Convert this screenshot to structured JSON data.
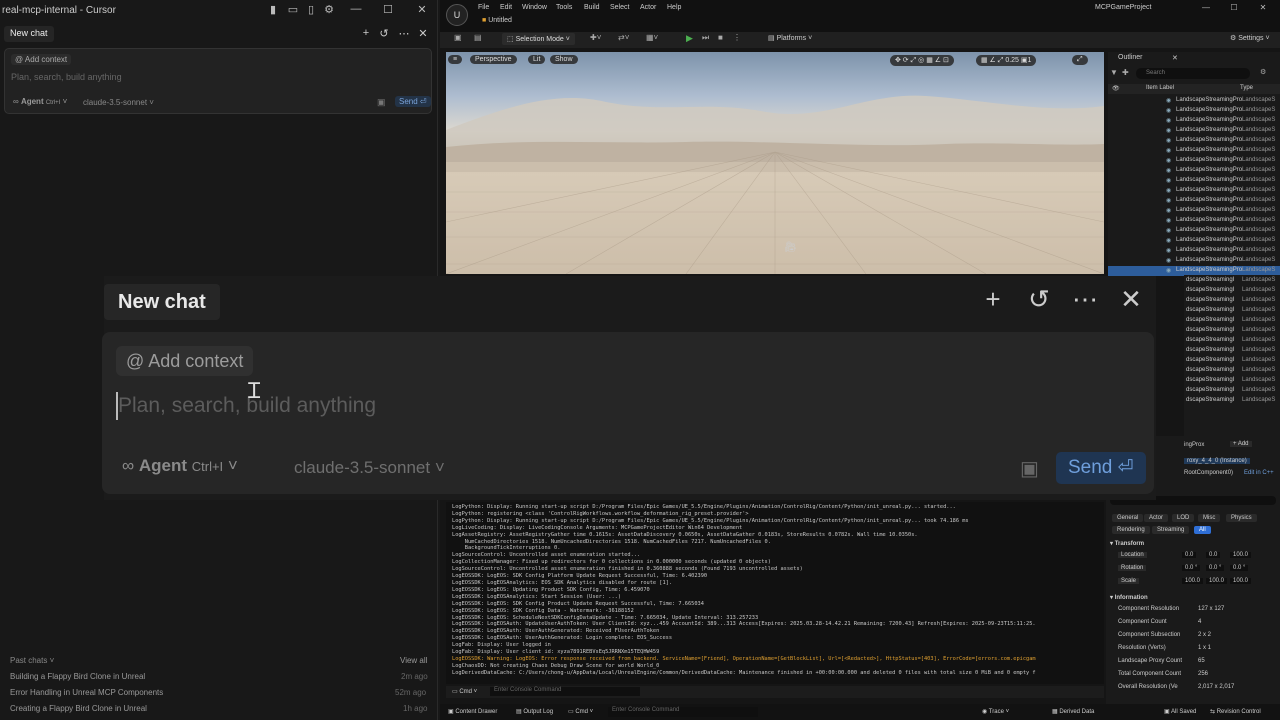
{
  "cursor": {
    "window_title": "real-mcp-internal - Cursor",
    "tab": "New chat",
    "add_context": "Add context",
    "placeholder": "Plan, search, build anything",
    "agent": "Agent",
    "agent_shortcut": "Ctrl+I",
    "model": "claude-3.5-sonnet",
    "send": "Send",
    "past_chats_label": "Past chats",
    "view_all": "View all",
    "past_chats": [
      {
        "title": "Building a Flappy Bird Clone in Unreal",
        "time": "2m ago"
      },
      {
        "title": "Error Handling in Unreal MCP Components",
        "time": "52m ago"
      },
      {
        "title": "Creating a Flappy Bird Clone in Unreal",
        "time": "1h ago"
      }
    ]
  },
  "unreal": {
    "menu": [
      "File",
      "Edit",
      "Window",
      "Tools",
      "Build",
      "Select",
      "Actor",
      "Help"
    ],
    "level": "Untitled",
    "project": "MCPGameProject",
    "selection_mode": "Selection Mode",
    "platforms": "Platforms",
    "settings": "Settings",
    "viewport_buttons": [
      "Perspective",
      "Lit",
      "Show"
    ],
    "outliner_title": "Outliner",
    "search_placeholder": "Search",
    "col_item": "Item Label",
    "col_type": "Type",
    "outliner_item": "LandscapeStreamingPro",
    "outliner_type": "LandscapeS",
    "outliner_lower_item": "dscapeStreamingI",
    "details_actor": "ingProx",
    "add_button": "+ Add",
    "details_instance": "roxy_4_4_0 (Instance)",
    "details_component": "RootComponent0)",
    "edit_in_cpp": "Edit in C++",
    "detail_tabs_row1": [
      "General",
      "Actor",
      "LOD",
      "Misc",
      "Physics"
    ],
    "detail_tabs_row2": [
      "Rendering",
      "Streaming",
      "All"
    ],
    "transform_label": "Transform",
    "transform": [
      {
        "label": "Location",
        "values": [
          "0.0",
          "0.0",
          "100.0"
        ]
      },
      {
        "label": "Rotation",
        "values": [
          "0.0 °",
          "0.0 °",
          "0.0 °"
        ]
      },
      {
        "label": "Scale",
        "values": [
          "100.0",
          "100.0",
          "100.0"
        ]
      }
    ],
    "information_label": "Information",
    "information": [
      {
        "label": "Component Resolution",
        "value": "127 x 127"
      },
      {
        "label": "Component Count",
        "value": "4"
      },
      {
        "label": "Component Subsection",
        "value": "2 x 2"
      },
      {
        "label": "Resolution (Verts)",
        "value": "1 x 1"
      },
      {
        "label": "Landscape Proxy Count",
        "value": "65"
      },
      {
        "label": "Total Component Count",
        "value": "256"
      },
      {
        "label": "Overall Resolution (Ve",
        "value": "2,017 x 2,017"
      }
    ],
    "log_lines": [
      {
        "text": "LogPython: Display: Running start-up script D:/Program Files/Epic Games/UE_5.5/Engine/Plugins/Animation/ControlRig/Content/Python/init_unreal.py... started...",
        "level": "normal"
      },
      {
        "text": "LogPython: registering <class 'ControlRigWorkflows.workflow_deformation_rig_preset.provider'>",
        "level": "normal"
      },
      {
        "text": "LogPython: Display: Running start-up script D:/Program Files/Epic Games/UE_5.5/Engine/Plugins/Animation/ControlRig/Content/Python/init_unreal.py... took 74.186 ms",
        "level": "normal"
      },
      {
        "text": "LogLiveCoding: Display: LiveCodingConsole Arguments: MCPGameProjectEditor Win64 Development",
        "level": "normal"
      },
      {
        "text": "LogAssetRegistry: AssetRegistryGather time 0.1615s: AssetDataDiscovery 0.0650s, AssetDataGather 0.0183s, StoreResults 0.0782s. Wall time 10.0350s.",
        "level": "normal"
      },
      {
        "text": "    NumCachedDirectories 1518. NumUncachedDirectories 1518. NumCachedFiles 7217. NumUncachedFiles 0.",
        "level": "normal"
      },
      {
        "text": "    BackgroundTickInterruptions 0.",
        "level": "normal"
      },
      {
        "text": "LogSourceControl: Uncontrolled asset enumeration started...",
        "level": "normal"
      },
      {
        "text": "LogCollectionManager: Fixed up redirectors for 0 collections in 0.000000 seconds (updated 0 objects)",
        "level": "normal"
      },
      {
        "text": "LogSourceControl: Uncontrolled asset enumeration finished in 0.360888 seconds (Found 7193 uncontrolled assets)",
        "level": "normal"
      },
      {
        "text": "LogEOSSDK: LogEOS: SDK Config Platform Update Request Successful, Time: 6.402390",
        "level": "normal"
      },
      {
        "text": "LogEOSSDK: LogEOSAnalytics: EOS SDK Analytics disabled for route [1].",
        "level": "normal"
      },
      {
        "text": "LogEOSSDK: LogEOS: Updating Product SDK Config, Time: 6.459070",
        "level": "normal"
      },
      {
        "text": "LogEOSSDK: LogEOSAnalytics: Start Session (User: ...)",
        "level": "normal"
      },
      {
        "text": "LogEOSSDK: LogEOS: SDK Config Product Update Request Successful, Time: 7.665034",
        "level": "normal"
      },
      {
        "text": "LogEOSSDK: LogEOS: SDK Config Data - Watermark: -36188152",
        "level": "normal"
      },
      {
        "text": "LogEOSSDK: LogEOS: ScheduleNextSDKConfigDataUpdate - Time: 7.665034, Update Interval: 313.257233",
        "level": "normal"
      },
      {
        "text": "LogEOSSDK: LogEOSAuth: UpdateUserAuthToken: User ClientId: xyz...459 AccountId: 389...313 Access[Expires: 2025.03.28-14.42.21 Remaining: 7200.43] Refresh[Expires: 2025-09-23T15:11:25.",
        "level": "normal"
      },
      {
        "text": "LogEOSSDK: LogEOSAuth: UserAuthGenerated: Received FUserAuthToken",
        "level": "normal"
      },
      {
        "text": "LogEOSSDK: LogEOSAuth: UserAuthGenerated: Login complete: EOS_Success",
        "level": "normal"
      },
      {
        "text": "LogFab: Display: User logged in",
        "level": "normal"
      },
      {
        "text": "LogFab: Display: User client id: xyza7891REBVsEq5JRRNXm15TEQHW459",
        "level": "normal"
      },
      {
        "text": "LogEOSSDK: Warning: LogEOS: Error response received from backend. ServiceName=[Friend], OperationName=[GetBlockList], Url=[<Redacted>], HttpStatus=[403], ErrorCode=[errors.com.epicgam",
        "level": "warn"
      },
      {
        "text": "LogChaosDD: Not creating Chaos Debug Draw Scene for world World_0",
        "level": "normal"
      },
      {
        "text": "LogDerivedDataCache: C:/Users/chong-u/AppData/Local/UnrealEngine/Common/DerivedDataCache: Maintenance finished in +00:00:00.000 and deleted 0 files with total size 0 MiB and 0 empty f",
        "level": "normal"
      }
    ],
    "cmd_label": "Cmd",
    "console_placeholder": "Enter Console Command",
    "content_drawer": "Content Drawer",
    "output_log": "Output Log",
    "trace": "Trace",
    "derived_data": "Derived Data",
    "all_saved": "All Saved",
    "revision_control": "Revision Control"
  },
  "colors": {
    "accent_blue": "#6f9fdc",
    "warning": "#e0a030",
    "play_green": "#4caf50"
  }
}
